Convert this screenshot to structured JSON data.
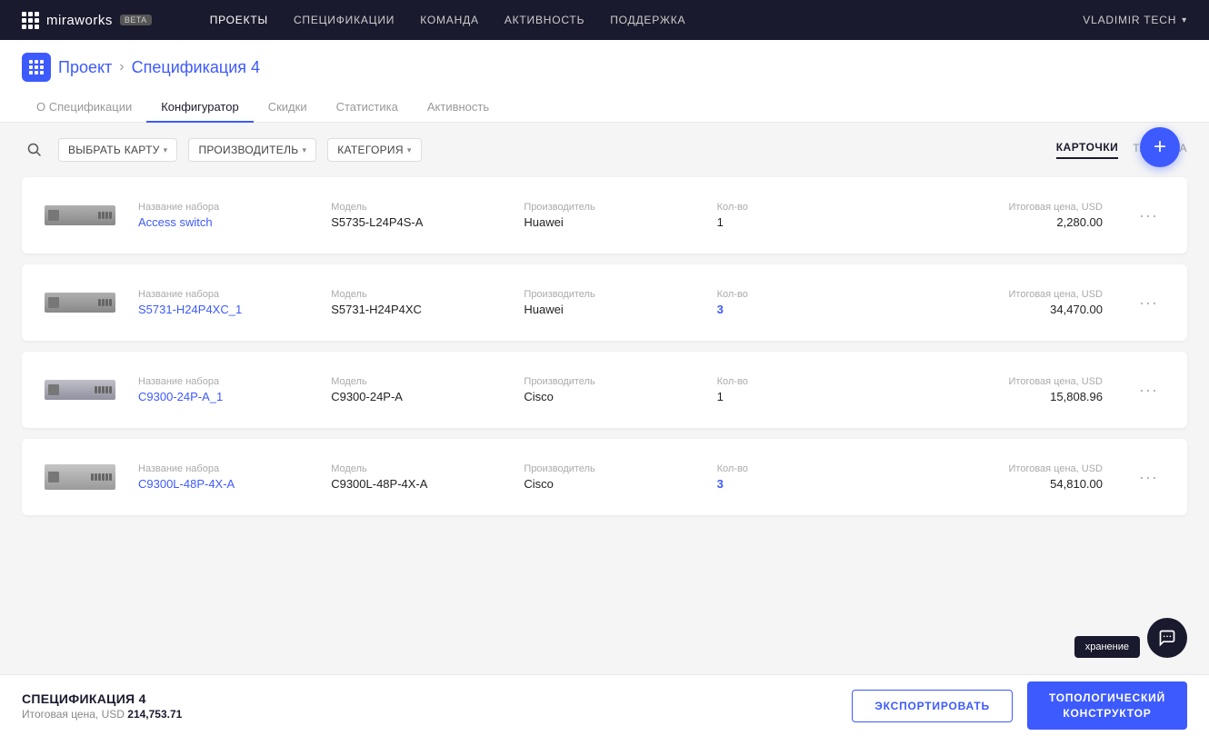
{
  "app": {
    "logo": "miraworks",
    "beta": "beta"
  },
  "nav": {
    "links": [
      {
        "label": "ПРОЕКТЫ",
        "active": true
      },
      {
        "label": "СПЕЦИФИКАЦИИ",
        "active": false
      },
      {
        "label": "КОМАНДА",
        "active": false
      },
      {
        "label": "АКТИВНОСТЬ",
        "active": false
      },
      {
        "label": "ПОДДЕРЖКА",
        "active": false
      }
    ],
    "user": "VLADIMIR TECH"
  },
  "breadcrumb": {
    "project": "Проект",
    "separator": "›",
    "current": "Спецификация 4"
  },
  "tabs": [
    {
      "label": "О Спецификации",
      "active": false
    },
    {
      "label": "Конфигуратор",
      "active": true
    },
    {
      "label": "Скидки",
      "active": false
    },
    {
      "label": "Статистика",
      "active": false
    },
    {
      "label": "Активность",
      "active": false
    }
  ],
  "toolbar": {
    "filters": [
      {
        "label": "ВЫБРАТЬ КАРТУ"
      },
      {
        "label": "ПРОИЗВОДИТЕЛЬ"
      },
      {
        "label": "КАТЕГОРИЯ"
      }
    ],
    "view_cards": "КАРТОЧКИ",
    "view_table": "ТАБЛИЦА"
  },
  "cards": [
    {
      "name_label": "Название набора",
      "name": "Access switch",
      "model_label": "Модель",
      "model": "S5735-L24P4S-A",
      "manufacturer_label": "Производитель",
      "manufacturer": "Huawei",
      "qty_label": "Кол-во",
      "qty": "1",
      "price_label": "Итоговая цена, USD",
      "price": "2,280.00"
    },
    {
      "name_label": "Название набора",
      "name": "S5731-H24P4XC_1",
      "model_label": "Модель",
      "model": "S5731-H24P4XC",
      "manufacturer_label": "Производитель",
      "manufacturer": "Huawei",
      "qty_label": "Кол-во",
      "qty": "3",
      "price_label": "Итоговая цена, USD",
      "price": "34,470.00"
    },
    {
      "name_label": "Название набора",
      "name": "C9300-24P-A_1",
      "model_label": "Модель",
      "model": "C9300-24P-A",
      "manufacturer_label": "Производитель",
      "manufacturer": "Cisco",
      "qty_label": "Кол-во",
      "qty": "1",
      "price_label": "Итоговая цена, USD",
      "price": "15,808.96"
    },
    {
      "name_label": "Название набора",
      "name": "C9300L-48P-4X-A",
      "model_label": "Модель",
      "model": "C9300L-48P-4X-A",
      "manufacturer_label": "Производитель",
      "manufacturer": "Cisco",
      "qty_label": "Кол-во",
      "qty": "3",
      "price_label": "Итоговая цена, USD",
      "price": "54,810.00"
    }
  ],
  "bottombar": {
    "spec_title": "СПЕЦИФИКАЦИЯ 4",
    "total_label": "Итоговая цена, USD",
    "total_value": "214,753.71",
    "export_btn": "ЭКСПОРТИРОВАТЬ",
    "topo_btn": "ТОПОЛОГИЧЕСКИЙ\nКОНСТРУКТОР"
  },
  "chat_toast": "хранение",
  "add_icon": "+",
  "chat_icon": "💬",
  "menu_icon": "···"
}
